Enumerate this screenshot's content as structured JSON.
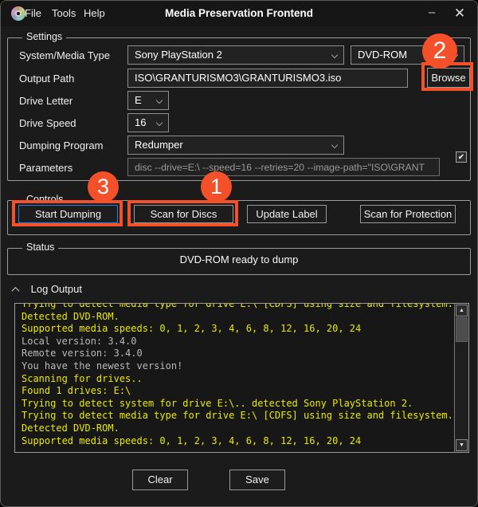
{
  "window": {
    "title": "Media Preservation Frontend",
    "menus": [
      "File",
      "Tools",
      "Help"
    ],
    "minimize_glyph": "–",
    "close_glyph": "✕"
  },
  "settings": {
    "legend": "Settings",
    "labels": {
      "system": "System/Media Type",
      "output": "Output Path",
      "drive_letter": "Drive Letter",
      "drive_speed": "Drive Speed",
      "program": "Dumping Program",
      "parameters": "Parameters"
    },
    "system_media_type": "Sony PlayStation 2",
    "media_type": "DVD-ROM",
    "output_path": "ISO\\GRANTURISMO3\\GRANTURISMO3.iso",
    "browse_label": "Browse",
    "drive_letter": "E",
    "drive_speed": "16",
    "dumping_program": "Redumper",
    "parameters_value": "disc --drive=E:\\ --speed=16 --retries=20 --image-path=\"ISO\\GRANT",
    "parameters_checkbox": "✔"
  },
  "controls": {
    "legend": "Controls",
    "start_dumping": "Start Dumping",
    "scan_for_discs": "Scan for Discs",
    "update_label": "Update Label",
    "scan_for_protection": "Scan for Protection"
  },
  "status": {
    "legend": "Status",
    "message": "DVD-ROM ready to dump"
  },
  "log": {
    "header": "Log Output",
    "scroll_up_glyph": "▲",
    "scroll_down_glyph": "▼",
    "lines": [
      {
        "text": "Trying to detect media type for drive E:\\ [CDFS] using size and filesystem..",
        "color": "yellow"
      },
      {
        "text": "Detected DVD-ROM.",
        "color": "yellow"
      },
      {
        "text": "Supported media speeds: 0, 1, 2, 3, 4, 6, 8, 12, 16, 20, 24",
        "color": "yellow"
      },
      {
        "text": "Local version: 3.4.0",
        "color": "gray"
      },
      {
        "text": "Remote version: 3.4.0",
        "color": "gray"
      },
      {
        "text": "You have the newest version!",
        "color": "gray"
      },
      {
        "text": "Scanning for drives..",
        "color": "yellow"
      },
      {
        "text": "Found 1 drives: E:\\",
        "color": "yellow"
      },
      {
        "text": "Trying to detect system for drive E:\\.. detected Sony PlayStation 2.",
        "color": "yellow"
      },
      {
        "text": "Trying to detect media type for drive E:\\ [CDFS] using size and filesystem..",
        "color": "yellow"
      },
      {
        "text": "Detected DVD-ROM.",
        "color": "yellow"
      },
      {
        "text": "Supported media speeds: 0, 1, 2, 3, 4, 6, 8, 12, 16, 20, 24",
        "color": "yellow"
      }
    ]
  },
  "footer": {
    "clear_label": "Clear",
    "save_label": "Save"
  },
  "annotations": {
    "accent_color": "#f4502a",
    "badge_scan_for_discs": "1",
    "badge_media_type": "2",
    "badge_start_dumping": "3"
  }
}
